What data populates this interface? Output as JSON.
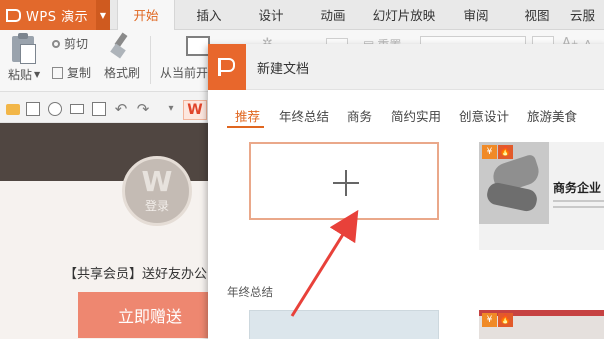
{
  "app": {
    "name": "WPS 演示"
  },
  "tabs": [
    "开始",
    "插入",
    "设计",
    "动画",
    "幻灯片放映",
    "审阅",
    "视图",
    "云服"
  ],
  "active_tab": "开始",
  "ribbon": {
    "paste": "粘贴",
    "cut": "剪切",
    "copy": "复制",
    "format_painter": "格式刷",
    "from_current": "从当前开",
    "reset": "重置",
    "font_grow": "A",
    "font_shrink": "A"
  },
  "left_panel": {
    "avatar_mark": "W",
    "login": "登录",
    "promo": "【共享会员】送好友办公",
    "gift_button": "立即赠送"
  },
  "dialog": {
    "title": "新建文档",
    "categories": [
      "推荐",
      "年终总结",
      "商务",
      "简约实用",
      "创意设计",
      "旅游美食"
    ],
    "active_category": "推荐",
    "blank_card": "+",
    "template_1": {
      "title": "商务企业",
      "badge_1": "¥",
      "badge_2": "🔥"
    },
    "section_2": "年终总结",
    "template_3": {
      "badge_1": "¥",
      "badge_2": "🔥"
    }
  },
  "colors": {
    "accent": "#e0661f",
    "brand": "#e2692c",
    "gift_button": "#ee8770",
    "arrow": "#e8413a"
  },
  "icons": [
    "paste-icon",
    "scissors-icon",
    "copy-icon",
    "format-painter-icon",
    "slide-show-icon",
    "open-icon",
    "save-icon",
    "print-icon",
    "undo-icon",
    "redo-icon",
    "wps-logo-icon"
  ]
}
